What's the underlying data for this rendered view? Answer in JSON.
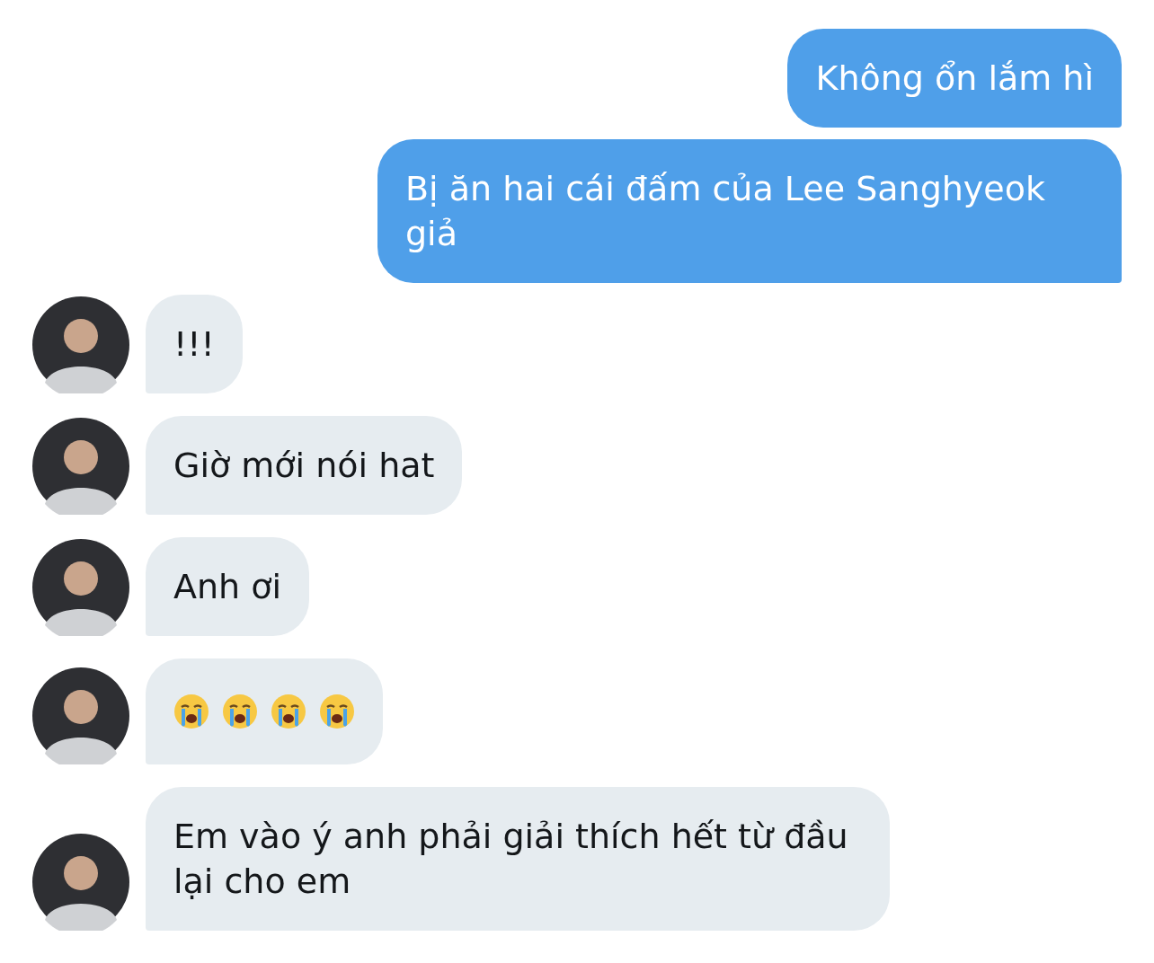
{
  "messages": [
    {
      "kind": "text",
      "outgoing": true,
      "text": "Không ổn lắm hì"
    },
    {
      "kind": "text",
      "outgoing": true,
      "text": "Bị ăn hai cái đấm của Lee Sanghyeok giả"
    },
    {
      "kind": "text",
      "outgoing": false,
      "text": "!!!"
    },
    {
      "kind": "text",
      "outgoing": false,
      "text": "Giờ mới nói hat"
    },
    {
      "kind": "text",
      "outgoing": false,
      "text": "Anh ơi"
    },
    {
      "kind": "icons",
      "outgoing": false,
      "icons": [
        {
          "kind": "crying"
        },
        {
          "kind": "crying"
        },
        {
          "kind": "crying"
        },
        {
          "kind": "crying"
        }
      ]
    },
    {
      "kind": "text",
      "outgoing": false,
      "text": "Em vào ý anh phải giải thích hết từ đầu lại cho em"
    }
  ]
}
